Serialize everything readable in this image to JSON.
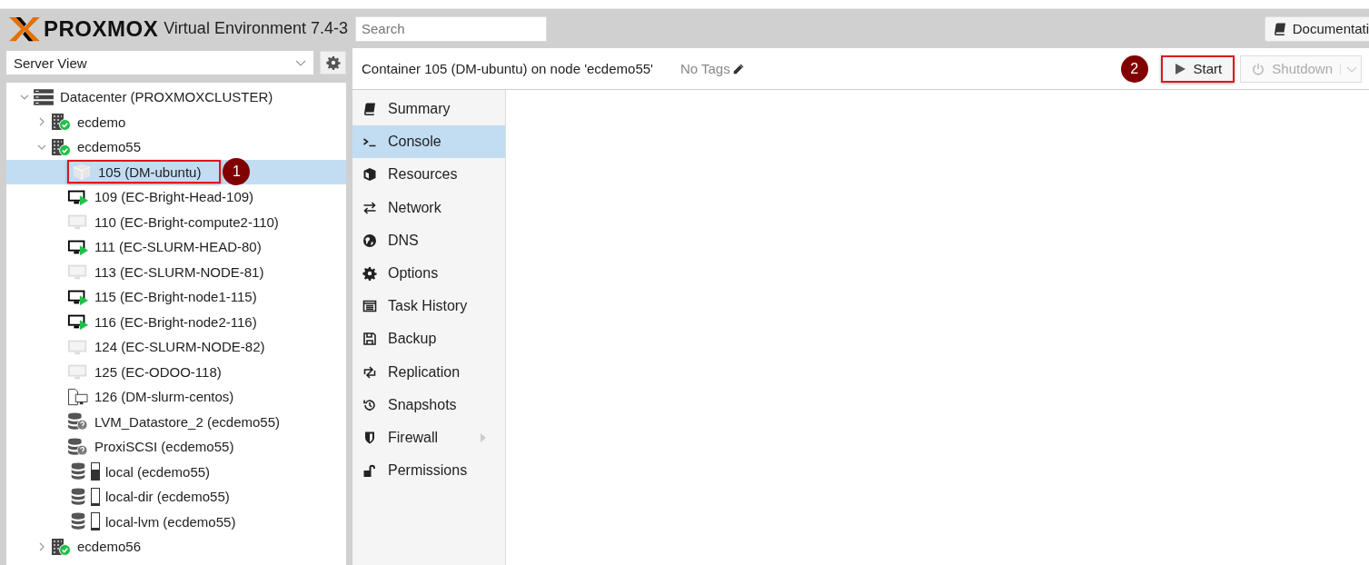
{
  "header": {
    "logo": "PROXMOX",
    "product": "Virtual Environment 7.4-3",
    "search": {
      "placeholder": "Search"
    },
    "documentation_button": "Documentati"
  },
  "sidebar": {
    "view_select": "Server View",
    "tree": [
      {
        "label": "Datacenter (PROXMOXCLUSTER)",
        "kind": "datacenter",
        "expanded": true,
        "children": [
          {
            "label": "ecdemo",
            "kind": "node",
            "online": true,
            "expanded": false
          },
          {
            "label": "ecdemo55",
            "kind": "node",
            "online": true,
            "expanded": true,
            "children": [
              {
                "label": "105 (DM-ubuntu)",
                "kind": "container",
                "running": false,
                "selected": true,
                "callout": "1"
              },
              {
                "label": "109 (EC-Bright-Head-109)",
                "kind": "vm",
                "running": true,
                "selected": false
              },
              {
                "label": "110 (EC-Bright-compute2-110)",
                "kind": "vm",
                "running": false,
                "selected": false
              },
              {
                "label": "111 (EC-SLURM-HEAD-80)",
                "kind": "vm",
                "running": true,
                "selected": false
              },
              {
                "label": "113 (EC-SLURM-NODE-81)",
                "kind": "vm",
                "running": false,
                "selected": false
              },
              {
                "label": "115 (EC-Bright-node1-115)",
                "kind": "vm",
                "running": true,
                "selected": false
              },
              {
                "label": "116 (EC-Bright-node2-116)",
                "kind": "vm",
                "running": true,
                "selected": false
              },
              {
                "label": "124 (EC-SLURM-NODE-82)",
                "kind": "vm",
                "running": false,
                "selected": false
              },
              {
                "label": "125 (EC-ODOO-118)",
                "kind": "vm",
                "running": false,
                "selected": false
              },
              {
                "label": "126 (DM-slurm-centos)",
                "kind": "template",
                "selected": false
              },
              {
                "label": "LVM_Datastore_2 (ecdemo55)",
                "kind": "storage-unknown",
                "selected": false
              },
              {
                "label": "ProxiSCSI (ecdemo55)",
                "kind": "storage-unknown",
                "selected": false
              },
              {
                "label": "local (ecdemo55)",
                "kind": "storage",
                "level": 0.6,
                "selected": false
              },
              {
                "label": "local-dir (ecdemo55)",
                "kind": "storage",
                "level": 0.1,
                "selected": false
              },
              {
                "label": "local-lvm (ecdemo55)",
                "kind": "storage",
                "level": 0.1,
                "selected": false
              }
            ]
          },
          {
            "label": "ecdemo56",
            "kind": "node",
            "online": true,
            "expanded": false
          }
        ]
      }
    ]
  },
  "toolbar": {
    "title": "Container 105 (DM-ubuntu) on node 'ecdemo55'",
    "tags": "No Tags",
    "buttons": [
      {
        "label": "Start",
        "kind": "start",
        "disabled": false,
        "callout": "2"
      },
      {
        "label": "Shutdown",
        "kind": "shutdown",
        "disabled": true
      }
    ]
  },
  "nav": [
    {
      "label": "Summary",
      "kind": "summary",
      "selected": false
    },
    {
      "label": "Console",
      "kind": "console",
      "selected": true
    },
    {
      "label": "Resources",
      "kind": "resources",
      "selected": false
    },
    {
      "label": "Network",
      "kind": "network",
      "selected": false
    },
    {
      "label": "DNS",
      "kind": "dns",
      "selected": false
    },
    {
      "label": "Options",
      "kind": "options",
      "selected": false
    },
    {
      "label": "Task History",
      "kind": "tasks",
      "selected": false
    },
    {
      "label": "Backup",
      "kind": "backup",
      "selected": false
    },
    {
      "label": "Replication",
      "kind": "replication",
      "selected": false
    },
    {
      "label": "Snapshots",
      "kind": "snapshots",
      "selected": false
    },
    {
      "label": "Firewall",
      "kind": "firewall",
      "selected": false,
      "submenu": true
    },
    {
      "label": "Permissions",
      "kind": "permissions",
      "selected": false
    }
  ]
}
